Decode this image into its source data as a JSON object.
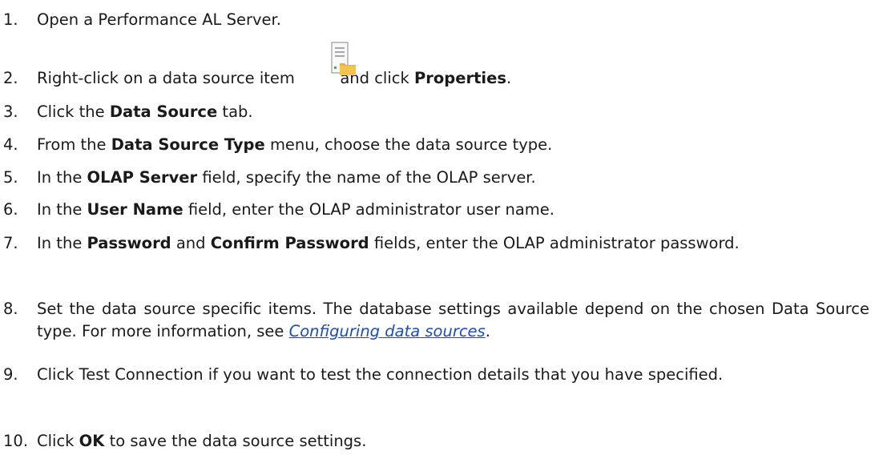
{
  "steps": [
    {
      "num": "1.",
      "text": "Open a Performance AL Server."
    },
    {
      "num": "2.",
      "before": "Right-click on a data source item",
      "mid": "and click",
      "bold": "Properties",
      "after": ".",
      "icon": "data-source-icon"
    },
    {
      "num": "3.",
      "before": "Click the",
      "bold": "Data Source",
      "after": "tab."
    },
    {
      "num": "4.",
      "before": "From the",
      "bold": "Data Source Type",
      "after": "menu, choose the data source type."
    },
    {
      "num": "5.",
      "before": "In the",
      "bold": "OLAP Server",
      "after": "field, specify the name of the OLAP server."
    },
    {
      "num": "6.",
      "before": "In the",
      "bold": "User Name",
      "after": "field, enter the OLAP administrator user name."
    },
    {
      "num": "7.",
      "before": "In the",
      "bold1": "Password",
      "mid": "and",
      "bold2": "Confirm Password",
      "after": "fields, enter the OLAP administrator password."
    },
    {
      "num": "8.",
      "before": "Set the data source specific items. The database settings available depend on the chosen Data Source type. For more information, see",
      "link": "Configuring data sources",
      "after": "."
    },
    {
      "num": "9.",
      "text": "Click Test Connection if you want to test the connection details that you have specified."
    },
    {
      "num": "10.",
      "before": "Click",
      "bold": "OK",
      "after": "to save the data source settings."
    }
  ]
}
